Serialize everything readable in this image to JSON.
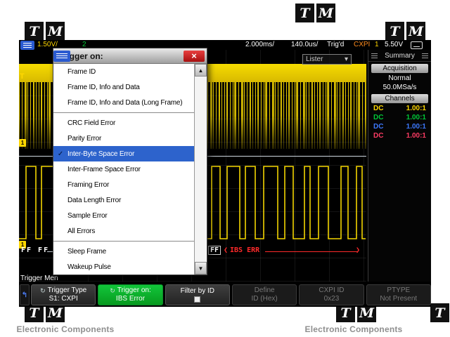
{
  "watermark": {
    "letters": [
      "T",
      "M"
    ],
    "brand_text": "Electronic Components"
  },
  "status_bar": {
    "ch1_scale": "1.50V/",
    "ch2_indicator": "2",
    "timebase": "2.000ms/",
    "zoom_timebase": "140.0us/",
    "trig_status": "Trig'd",
    "bus_type": "CXPI",
    "trig_source": "1",
    "trig_level": "5.50V"
  },
  "dropdown": {
    "title": "Trigger on:",
    "items": [
      {
        "label": "Frame ID"
      },
      {
        "label": "Frame ID, Info and Data"
      },
      {
        "label": "Frame ID, Info and Data (Long Frame)"
      },
      {
        "separator": true
      },
      {
        "label": "CRC Field Error"
      },
      {
        "label": "Parity Error"
      },
      {
        "label": "Inter-Byte Space Error",
        "selected": true
      },
      {
        "label": "Inter-Frame Space Error"
      },
      {
        "label": "Framing Error"
      },
      {
        "label": "Data Length Error"
      },
      {
        "label": "Sample Error"
      },
      {
        "label": "All Errors"
      },
      {
        "separator": true
      },
      {
        "label": "Sleep Frame"
      },
      {
        "label": "Wakeup Pulse"
      }
    ]
  },
  "lister": {
    "label": "Lister"
  },
  "sidebar": {
    "title": "Summary",
    "acquisition_header": "Acquisition",
    "acq_mode": "Normal",
    "sample_rate": "50.0MSa/s",
    "channels_header": "Channels",
    "channels": [
      {
        "coupling": "DC",
        "probe": "1.00:1",
        "color": "#ffd700"
      },
      {
        "coupling": "DC",
        "probe": "1.00:1",
        "color": "#00c837"
      },
      {
        "coupling": "DC",
        "probe": "1.00:1",
        "color": "#3c78ff"
      },
      {
        "coupling": "DC",
        "probe": "1.00:1",
        "color": "#ff3c64"
      }
    ]
  },
  "waveform": {
    "decode_left": "FF FF",
    "decode_mid": "FF",
    "decode_error": "IBS ERR"
  },
  "markers": {
    "trigger": "T",
    "ch1_ground": "1"
  },
  "menu_label": "Trigger Men",
  "softkeys": [
    {
      "line1": "Trigger Type",
      "line2": "S1: CXPI",
      "state": "",
      "icon": true
    },
    {
      "line1": "Trigger on:",
      "line2": "IBS Error",
      "state": "green",
      "icon": true
    },
    {
      "line1": "Filter by ID",
      "checkbox": true,
      "state": ""
    },
    {
      "line1": "Define",
      "line2": "ID (Hex)",
      "state": "disabled"
    },
    {
      "line1": "CXPI ID",
      "line2": "0x23",
      "state": "disabled"
    },
    {
      "line1": "PTYPE",
      "line2": "Not Present",
      "state": "disabled"
    }
  ],
  "icons": {
    "close": "×",
    "scroll_up": "▲",
    "scroll_down": "▼",
    "chevron_down": "▾",
    "cycle": "↻",
    "back": "↰",
    "check": "✓"
  },
  "colors": {
    "ch1": "#ffd700",
    "ch2": "#00c837",
    "ch3": "#3c78ff",
    "ch4": "#ff3c64",
    "bus_orange": "#ff8c1e",
    "error_red": "#ff2a2a",
    "selected_blue": "#2d63cc",
    "softkey_green": "#0fc832"
  }
}
